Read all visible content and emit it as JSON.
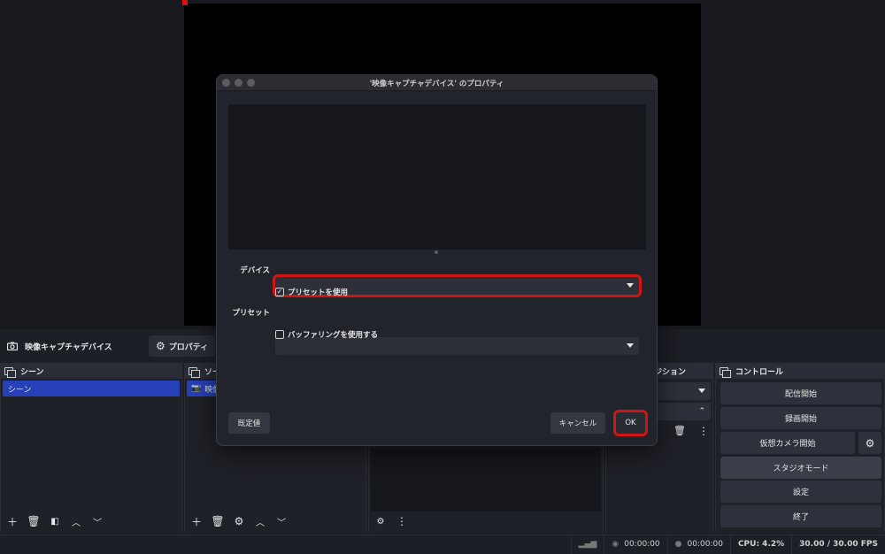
{
  "preview": {
    "canvas_color": "#000000"
  },
  "source_toolbar": {
    "source_name": "映像キャプチャデバイス",
    "properties_label": "プロパティ"
  },
  "scenes": {
    "title": "シーン",
    "items": [
      "シーン"
    ]
  },
  "sources": {
    "title": "ソース",
    "title_visible": "ソー",
    "items": [
      "映像"
    ]
  },
  "transitions": {
    "title_visible": "ジション"
  },
  "controls": {
    "title": "コントロール",
    "buttons": [
      "配信開始",
      "録画開始",
      "仮想カメラ開始",
      "スタジオモード",
      "設定",
      "終了"
    ]
  },
  "status": {
    "rec_time": "00:00:00",
    "stream_time": "00:00:00",
    "cpu": "CPU: 4.2%",
    "fps": "30.00 / 30.00 FPS"
  },
  "modal": {
    "title": "'映像キャプチャデバイス' のプロパティ",
    "device_label": "デバイス",
    "device_value": "",
    "use_preset_label": "プリセットを使用",
    "use_preset_checked": true,
    "preset_label": "プリセット",
    "preset_value": "",
    "use_buffering_label": "バッファリングを使用する",
    "use_buffering_checked": false,
    "defaults_button": "既定値",
    "cancel_button": "キャンセル",
    "ok_button": "OK",
    "highlight_color": "#d01515"
  }
}
